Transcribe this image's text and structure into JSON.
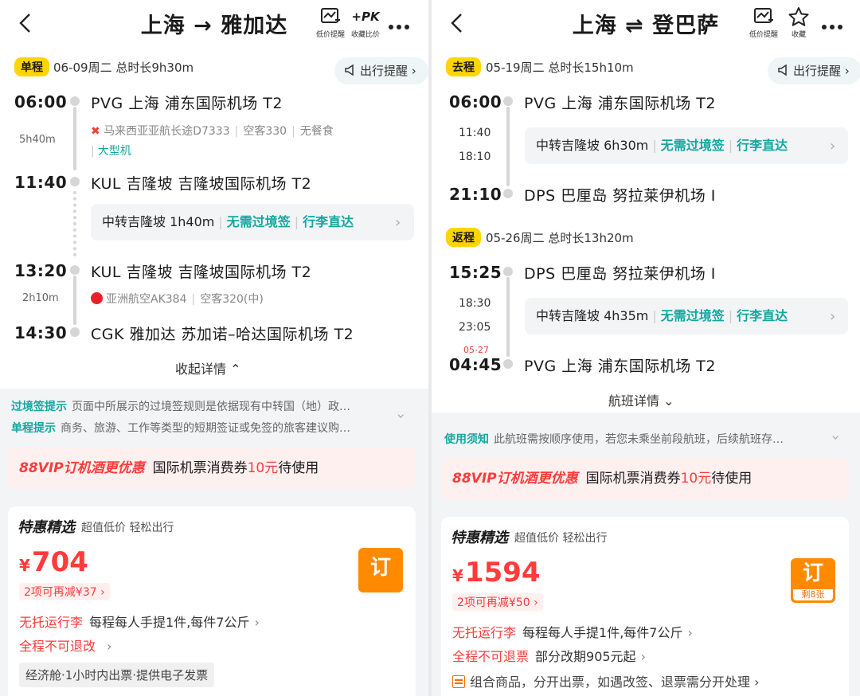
{
  "left": {
    "title": "上海 → 雅加达",
    "icons": {
      "price_alert": "低价提醒",
      "pk_label": "+PK",
      "pk_sub": "收藏比价"
    },
    "badge": "单程",
    "seg_info": "06-09周二   总时长9h30m",
    "reminder": "出行提醒",
    "leg1": {
      "dep_time": "06:00",
      "dep_airport": "PVG  上海  浦东国际机场  T2",
      "duration": "5h40m",
      "airline": "马来西亚亚航长途D7333",
      "aircraft": "空客330",
      "meal": "无餐食",
      "tag": "大型机",
      "arr_time": "11:40",
      "arr_airport": "KUL  吉隆坡  吉隆坡国际机场  T2"
    },
    "transfer": {
      "city": "中转吉隆坡 1h40m",
      "visa": "无需过境签",
      "luggage": "行李直达"
    },
    "leg2": {
      "dep_time": "13:20",
      "dep_airport": "KUL  吉隆坡  吉隆坡国际机场  T2",
      "duration": "2h10m",
      "airline": "亚洲航空AK384",
      "aircraft": "空客320(中)",
      "arr_time": "14:30",
      "arr_airport": "CGK  雅加达  苏加诺–哈达国际机场  T2"
    },
    "collapse": "收起详情",
    "notice1_label": "过境签提示",
    "notice1_text": "页面中所展示的过境签规则是依据现有中转国（地）政…",
    "notice2_label": "单程提示",
    "notice2_text": "商务、旅游、工作等类型的短期签证或免签的旅客建议购…",
    "vip": {
      "brand": "88VIP订机酒更优惠",
      "text_a": "国际机票消费券",
      "amount": "10元",
      "text_b": "待使用"
    },
    "deal": {
      "title": "特惠精选",
      "sub": "超值低价  轻松出行",
      "currency": "¥",
      "price": "704",
      "reduce": "2项可再减¥37",
      "book": "订",
      "rule1_red": "无托运行李",
      "rule1_text": "每程每人手提1件,每件7公斤",
      "rule2_red": "全程不可退改",
      "rule2_text": "",
      "tags": "经济舱·1小时内出票·提供电子发票"
    }
  },
  "right": {
    "title": "上海 ⇌ 登巴萨",
    "icons": {
      "price_alert": "低价提醒",
      "fav": "收藏"
    },
    "out_badge": "去程",
    "out_info": "05-19周二   总时长15h10m",
    "reminder": "出行提醒",
    "out": {
      "dep_time": "06:00",
      "dep_airport": "PVG  上海  浦东国际机场  T2",
      "t1": "11:40",
      "t2": "18:10",
      "transfer": {
        "city": "中转吉隆坡 6h30m",
        "visa": "无需过境签",
        "luggage": "行李直达"
      },
      "arr_time": "21:10",
      "arr_airport": "DPS  巴厘岛  努拉莱伊机场  I"
    },
    "ret_badge": "返程",
    "ret_info": "05-26周二   总时长13h20m",
    "ret": {
      "dep_time": "15:25",
      "dep_airport": "DPS  巴厘岛  努拉莱伊机场  I",
      "t1": "18:30",
      "t2": "23:05",
      "transfer": {
        "city": "中转吉隆坡 4h35m",
        "visa": "无需过境签",
        "luggage": "行李直达"
      },
      "next_day": "05-27",
      "arr_time": "04:45",
      "arr_airport": "PVG  上海  浦东国际机场  T2"
    },
    "details": "航班详情",
    "notice_label": "使用须知",
    "notice_text": "此航班需按顺序使用，若您未乘坐前段航班，后续航班存…",
    "vip": {
      "brand": "88VIP订机酒更优惠",
      "text_a": "国际机票消费券",
      "amount": "10元",
      "text_b": "待使用"
    },
    "deal": {
      "title": "特惠精选",
      "sub": "超值低价  轻松出行",
      "currency": "¥",
      "price": "1594",
      "reduce": "2项可再减¥50",
      "book": "订",
      "left": "剩8张",
      "rule1_red": "无托运行李",
      "rule1_text": "每程每人手提1件,每件7公斤",
      "rule2_red": "全程不可退票",
      "rule2_text": "部分改期905元起",
      "combo": "组合商品，分开出票，如遇改签、退票需分开处理"
    }
  },
  "colors": {
    "accent_green": "#14a7a0",
    "price_red": "#ff3b3b",
    "book_orange": "#ff8a00",
    "badge_yellow": "#ffd500"
  }
}
